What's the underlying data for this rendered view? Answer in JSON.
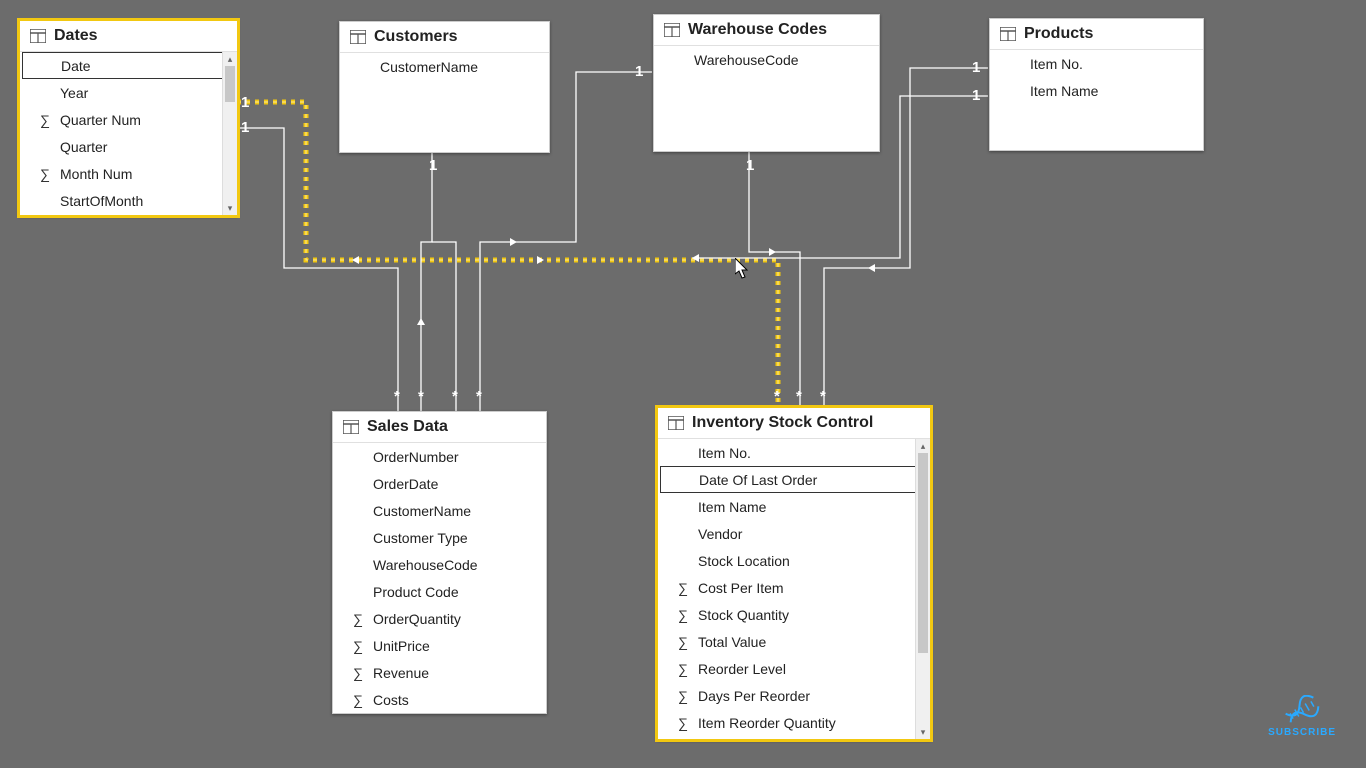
{
  "icons": {
    "sigma": "∑"
  },
  "tables": {
    "dates": {
      "title": "Dates",
      "selected": true,
      "keyField": "Date",
      "fields": [
        {
          "name": "Date",
          "agg": false,
          "key": true
        },
        {
          "name": "Year",
          "agg": false
        },
        {
          "name": "Quarter Num",
          "agg": true
        },
        {
          "name": "Quarter",
          "agg": false
        },
        {
          "name": "Month Num",
          "agg": true
        },
        {
          "name": "StartOfMonth",
          "agg": false
        }
      ]
    },
    "customers": {
      "title": "Customers",
      "fields": [
        {
          "name": "CustomerName",
          "agg": false
        }
      ]
    },
    "warehouse": {
      "title": "Warehouse Codes",
      "fields": [
        {
          "name": "WarehouseCode",
          "agg": false
        }
      ]
    },
    "products": {
      "title": "Products",
      "fields": [
        {
          "name": "Item No.",
          "agg": false
        },
        {
          "name": "Item Name",
          "agg": false
        }
      ]
    },
    "sales": {
      "title": "Sales Data",
      "fields": [
        {
          "name": "OrderNumber",
          "agg": false
        },
        {
          "name": "OrderDate",
          "agg": false
        },
        {
          "name": "CustomerName",
          "agg": false
        },
        {
          "name": "Customer Type",
          "agg": false
        },
        {
          "name": "WarehouseCode",
          "agg": false
        },
        {
          "name": "Product Code",
          "agg": false
        },
        {
          "name": "OrderQuantity",
          "agg": true
        },
        {
          "name": "UnitPrice",
          "agg": true
        },
        {
          "name": "Revenue",
          "agg": true
        },
        {
          "name": "Costs",
          "agg": true
        }
      ]
    },
    "inventory": {
      "title": "Inventory Stock Control",
      "selected": true,
      "keyField": "Date Of Last Order",
      "fields": [
        {
          "name": "Item No.",
          "agg": false
        },
        {
          "name": "Date Of Last Order",
          "agg": false,
          "key": true
        },
        {
          "name": "Item Name",
          "agg": false
        },
        {
          "name": "Vendor",
          "agg": false
        },
        {
          "name": "Stock Location",
          "agg": false
        },
        {
          "name": "Cost Per Item",
          "agg": true
        },
        {
          "name": "Stock Quantity",
          "agg": true
        },
        {
          "name": "Total Value",
          "agg": true
        },
        {
          "name": "Reorder Level",
          "agg": true
        },
        {
          "name": "Days Per Reorder",
          "agg": true
        },
        {
          "name": "Item Reorder Quantity",
          "agg": true
        }
      ]
    }
  },
  "cardinality": {
    "dates_out1": "1",
    "dates_out2": "1",
    "customers_one": "1",
    "customers_many": "*",
    "wh_one_left": "1",
    "wh_one_bottom": "1",
    "prod_one_top": "1",
    "prod_one_bot": "1",
    "sales_many1": "*",
    "sales_many2": "*",
    "sales_many3": "*",
    "sales_many4": "*",
    "inv_many1": "*",
    "inv_many2": "*",
    "inv_many3": "*"
  },
  "watermark": "SUBSCRIBE"
}
